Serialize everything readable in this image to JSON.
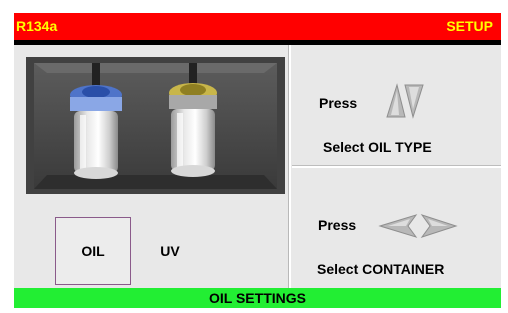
{
  "header": {
    "refrigerant": "R134a",
    "mode": "SETUP"
  },
  "selector": {
    "options": [
      "OIL",
      "UV"
    ],
    "selected": "OIL"
  },
  "instructions": {
    "oil_type": {
      "press_label": "Press",
      "action": "Select OIL TYPE",
      "icon": "up-down-arrows-icon"
    },
    "container": {
      "press_label": "Press",
      "action": "Select CONTAINER",
      "icon": "left-right-arrows-icon"
    }
  },
  "status": {
    "label": "OIL SETTINGS"
  },
  "colors": {
    "title_bar": "#ff0000",
    "title_text": "#ffff00",
    "status_bar": "#22ee33",
    "panel_bg": "#e8e8e8"
  }
}
